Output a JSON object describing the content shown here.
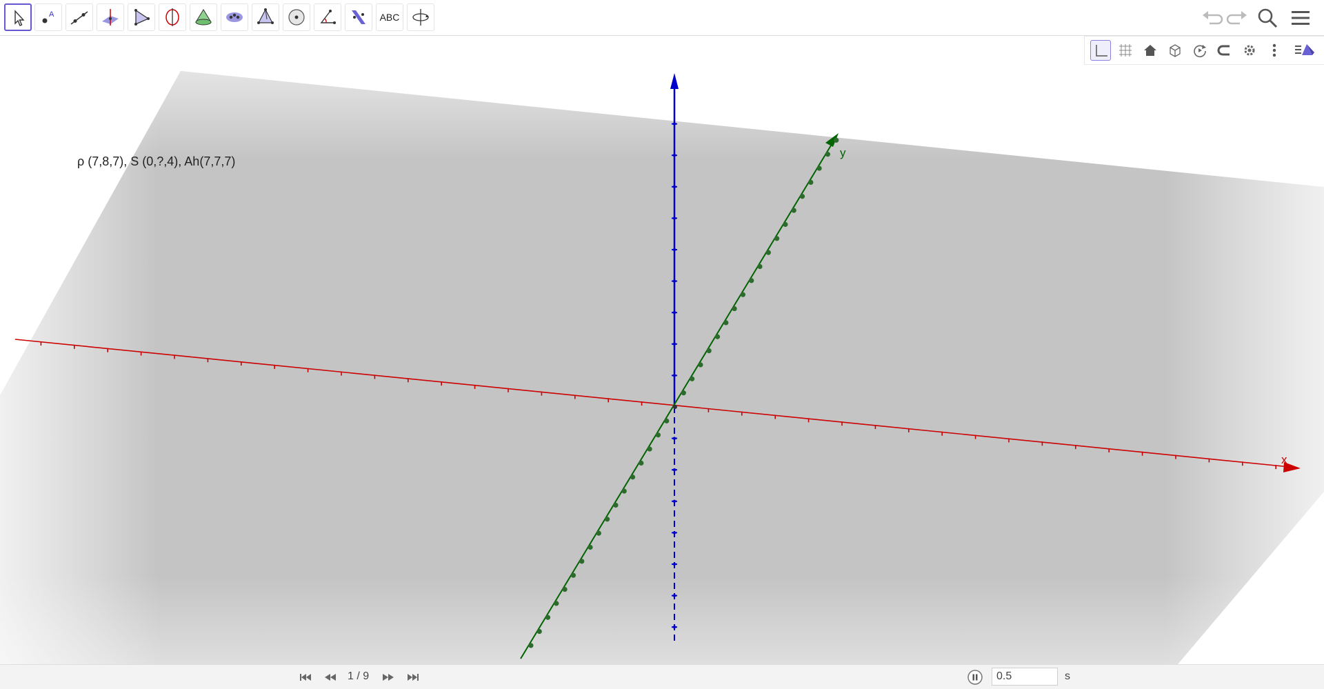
{
  "toolbar": {
    "tools": [
      {
        "name": "move-tool",
        "icon": "cursor-arrow-icon",
        "active": true
      },
      {
        "name": "point-tool",
        "icon": "point-icon"
      },
      {
        "name": "line-tool",
        "icon": "line-through-points-icon"
      },
      {
        "name": "perpendicular-line-tool",
        "icon": "perpendicular-line-icon"
      },
      {
        "name": "polygon-tool",
        "icon": "polygon-icon"
      },
      {
        "name": "circle-axis-tool",
        "icon": "circle-around-axis-icon"
      },
      {
        "name": "cone-tool",
        "icon": "cone-icon"
      },
      {
        "name": "intersect-tool",
        "icon": "intersect-surfaces-icon"
      },
      {
        "name": "pyramid-tool",
        "icon": "pyramid-icon"
      },
      {
        "name": "sphere-tool",
        "icon": "sphere-icon"
      },
      {
        "name": "angle-tool",
        "icon": "angle-icon"
      },
      {
        "name": "reflect-tool",
        "icon": "reflect-about-plane-icon"
      },
      {
        "name": "text-tool",
        "icon": "text-icon",
        "label": "ABC"
      },
      {
        "name": "rotate-view-tool",
        "icon": "rotate-view-icon"
      }
    ],
    "right": [
      "undo-icon",
      "redo-icon",
      "search-icon",
      "menu-icon"
    ]
  },
  "style_bar": [
    "axes-icon",
    "grid-icon",
    "home-icon",
    "view-cube-icon",
    "rotate-icon",
    "projection-icon",
    "settings-icon",
    "more-vertical-icon",
    "toggle-style-bar-icon"
  ],
  "graphics": {
    "caption": "ρ (7,8,7), S (0,?,4), Ah(7,7,7)",
    "x_label": "x",
    "y_label": "y",
    "colors": {
      "x_axis": "#cc0000",
      "y_axis": "#006400",
      "z_axis": "#0000cc",
      "plane": "#bdbdbd"
    }
  },
  "animation": {
    "page_counter": "1 / 9",
    "speed_value": "0.5",
    "speed_unit": "s"
  }
}
